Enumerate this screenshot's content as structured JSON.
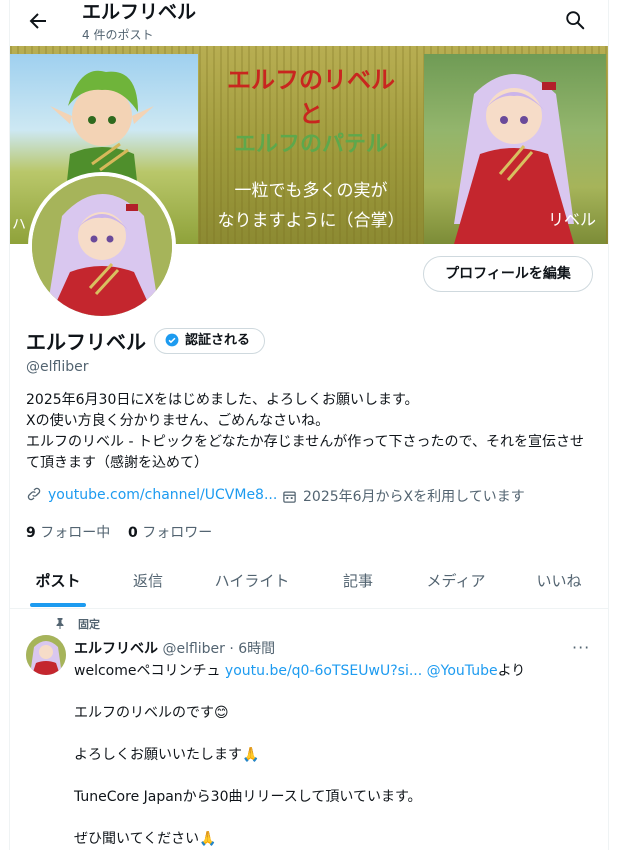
{
  "header": {
    "name": "エルフリベル",
    "post_count": "4 件のポスト"
  },
  "banner": {
    "line1": "エルフのリベル",
    "line2": "と",
    "line3": "エルフのパテル",
    "line4": "一粒でも多くの実が",
    "line5": "なりますように（合掌）",
    "sig_right": "リベル",
    "sig_left": "ハ"
  },
  "profile": {
    "edit_button": "プロフィールを編集",
    "name": "エルフリベル",
    "verified_label": "認証される",
    "handle": "@elfliber",
    "bio": [
      "2025年6月30日にXをはじめました、よろしくお願いします。",
      "Xの使い方良く分かりません、ごめんなさいね。",
      "エルフのリベル - トピックをどなたか存じませんが作って下さったので、それを宣伝させて頂きます（感謝を込めて）"
    ],
    "link": "youtube.com/channel/UCVMe8...",
    "joined": "2025年6月からXを利用しています",
    "following_count": "9",
    "following_label": "フォロー中",
    "followers_count": "0",
    "followers_label": "フォロワー"
  },
  "tabs": [
    {
      "label": "ポスト",
      "active": true
    },
    {
      "label": "返信"
    },
    {
      "label": "ハイライト"
    },
    {
      "label": "記事"
    },
    {
      "label": "メディア"
    },
    {
      "label": "いいね"
    }
  ],
  "tweet": {
    "pinned_label": "固定",
    "name": "エルフリベル",
    "handle_time": "@elfliber · 6時間",
    "more": "···",
    "line1_prefix": "welcomeペコリンチュ ",
    "line1_link": "youtu.be/q0-6oTSEUwU?si...",
    "line1_mention": " @YouTube",
    "line1_suffix": "より",
    "line2": "エルフのリベルのです😊",
    "line3": "よろしくお願いいたします🙏",
    "line4": "TuneCore Japanから30曲リリースして頂いています。",
    "line5": "ぜひ聞いてください🙏"
  },
  "icons": [
    "back-arrow-icon",
    "search-icon",
    "verified-badge-icon",
    "link-icon",
    "calendar-icon",
    "pin-icon",
    "more-icon"
  ],
  "colors": {
    "accent": "#1d9bf0",
    "text": "#0f1419",
    "muted": "#536471",
    "border": "#cfd9de"
  }
}
